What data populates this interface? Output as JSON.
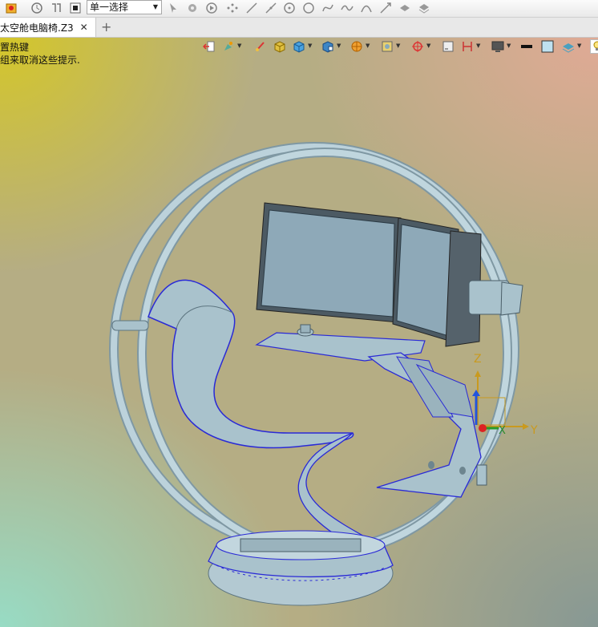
{
  "toolbar": {
    "selector_value": "单一选择",
    "icons": [
      "app-icon",
      "clock-icon",
      "filter-icon",
      "stop-icon",
      "pointer-icon",
      "gear-icon",
      "play-icon",
      "nodes-icon",
      "line-icon",
      "segment-icon",
      "circle-point-icon",
      "circle-icon",
      "spline-icon",
      "wave-icon",
      "arc-icon",
      "arrow-line-icon",
      "stack-icon",
      "layers-icon"
    ]
  },
  "tabs": {
    "document_tab": "太空舱电脑椅.Z3"
  },
  "viewport": {
    "hint_line1": "置热键",
    "hint_line2": "组来取消这些提示.",
    "view_tool_icons": [
      "exit-icon",
      "paint-icon",
      "brush-icon",
      "cube-box-icon",
      "cube-icon",
      "cube-view-icon",
      "sphere-icon",
      "frame-icon",
      "target-icon",
      "ruler-icon",
      "section-icon",
      "monitor-icon",
      "line-style-icon",
      "color-square-icon",
      "layer-icon",
      "bulb-icon"
    ],
    "triad_labels": {
      "z": "Z",
      "x": "X",
      "y": "Y"
    }
  },
  "colors": {
    "model_fill": "#a9c2cc",
    "edge_blue": "#2a2ad6",
    "triad_z": "#c99a1f",
    "triad_y": "#c99a1f",
    "triad_x_blue": "#2255dd"
  }
}
